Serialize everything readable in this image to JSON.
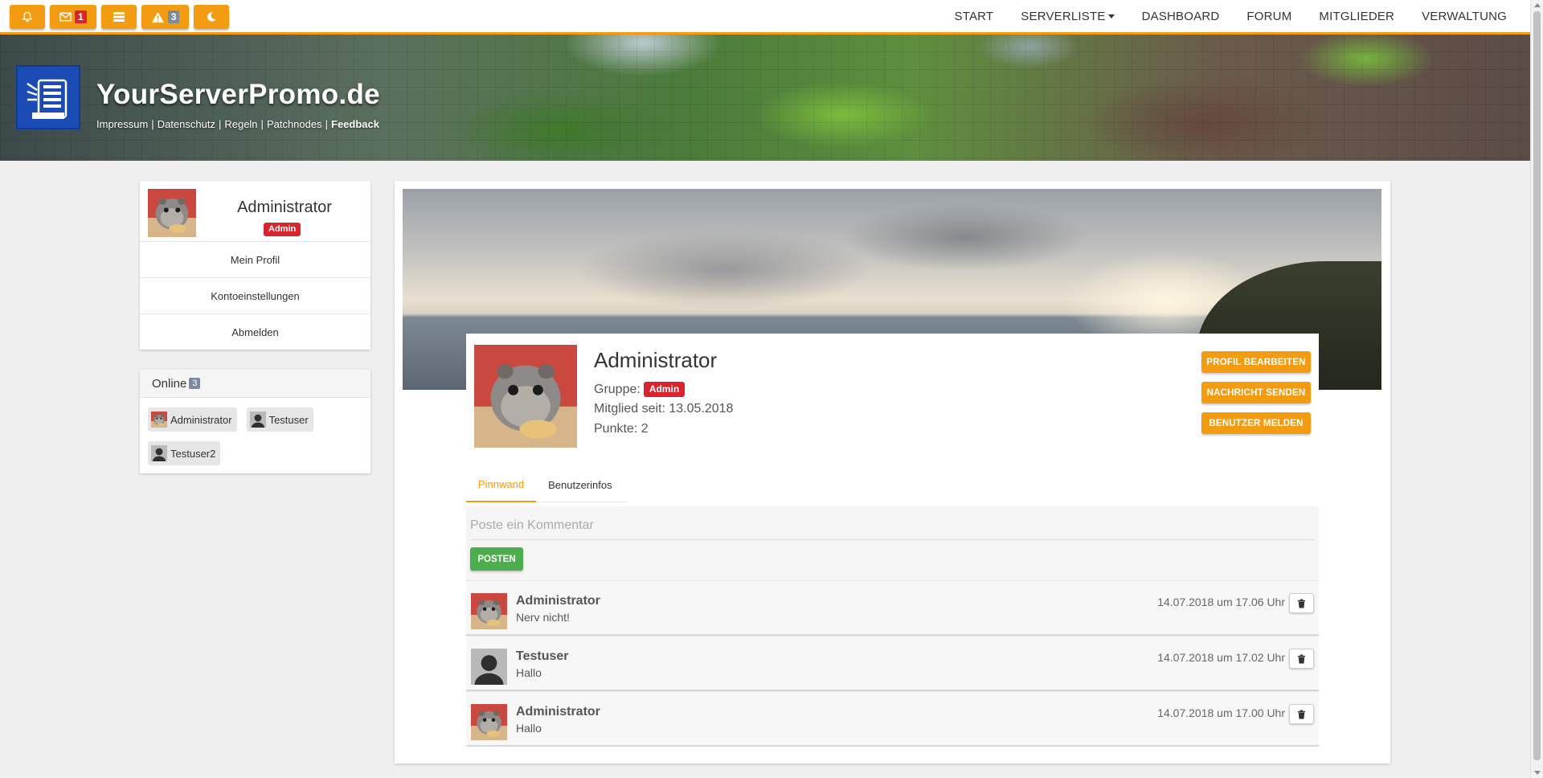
{
  "topbar": {
    "buttons": [
      {
        "icon": "bell-icon"
      },
      {
        "icon": "envelope-icon",
        "count": "1"
      },
      {
        "icon": "server-list-icon"
      },
      {
        "icon": "warning-icon",
        "count": "3"
      },
      {
        "icon": "moon-icon"
      }
    ],
    "nav": [
      "START",
      "SERVERLISTE",
      "DASHBOARD",
      "FORUM",
      "MITGLIEDER",
      "VERWALTUNG"
    ],
    "accent_color": "#f39c12"
  },
  "header": {
    "title": "YourServerPromo.de",
    "links": [
      "Impressum",
      "Datenschutz",
      "Regeln",
      "Patchnodes"
    ],
    "links_separator": "|",
    "feedback": "Feedback"
  },
  "sidebar": {
    "user": {
      "name": "Administrator",
      "badge": "Admin"
    },
    "menu": [
      "Mein Profil",
      "Kontoeinstellungen",
      "Abmelden"
    ],
    "online": {
      "title": "Online",
      "count": "3",
      "users": [
        "Administrator",
        "Testuser",
        "Testuser2"
      ]
    }
  },
  "profile": {
    "name": "Administrator",
    "group_label": "Gruppe:",
    "group": "Admin",
    "member_since": "Mitglied seit: 13.05.2018",
    "points": "Punkte: 2",
    "buttons": [
      "PROFIL BEARBEITEN",
      "NACHRICHT SENDEN",
      "BENUTZER MELDEN"
    ],
    "tabs": [
      "Pinnwand",
      "Benutzerinfos"
    ],
    "comment_placeholder": "Poste ein Kommentar",
    "post_button": "POSTEN",
    "posts": [
      {
        "author": "Administrator",
        "text": "Nerv nicht!",
        "time": "14.07.2018 um 17.06 Uhr"
      },
      {
        "author": "Testuser",
        "text": "Hallo",
        "time": "14.07.2018 um 17.02 Uhr"
      },
      {
        "author": "Administrator",
        "text": "Hallo",
        "time": "14.07.2018 um 17.00 Uhr"
      }
    ]
  },
  "colors": {
    "accent": "#f39c12",
    "badge_red": "#d9232d",
    "post_green": "#4cae4c"
  }
}
